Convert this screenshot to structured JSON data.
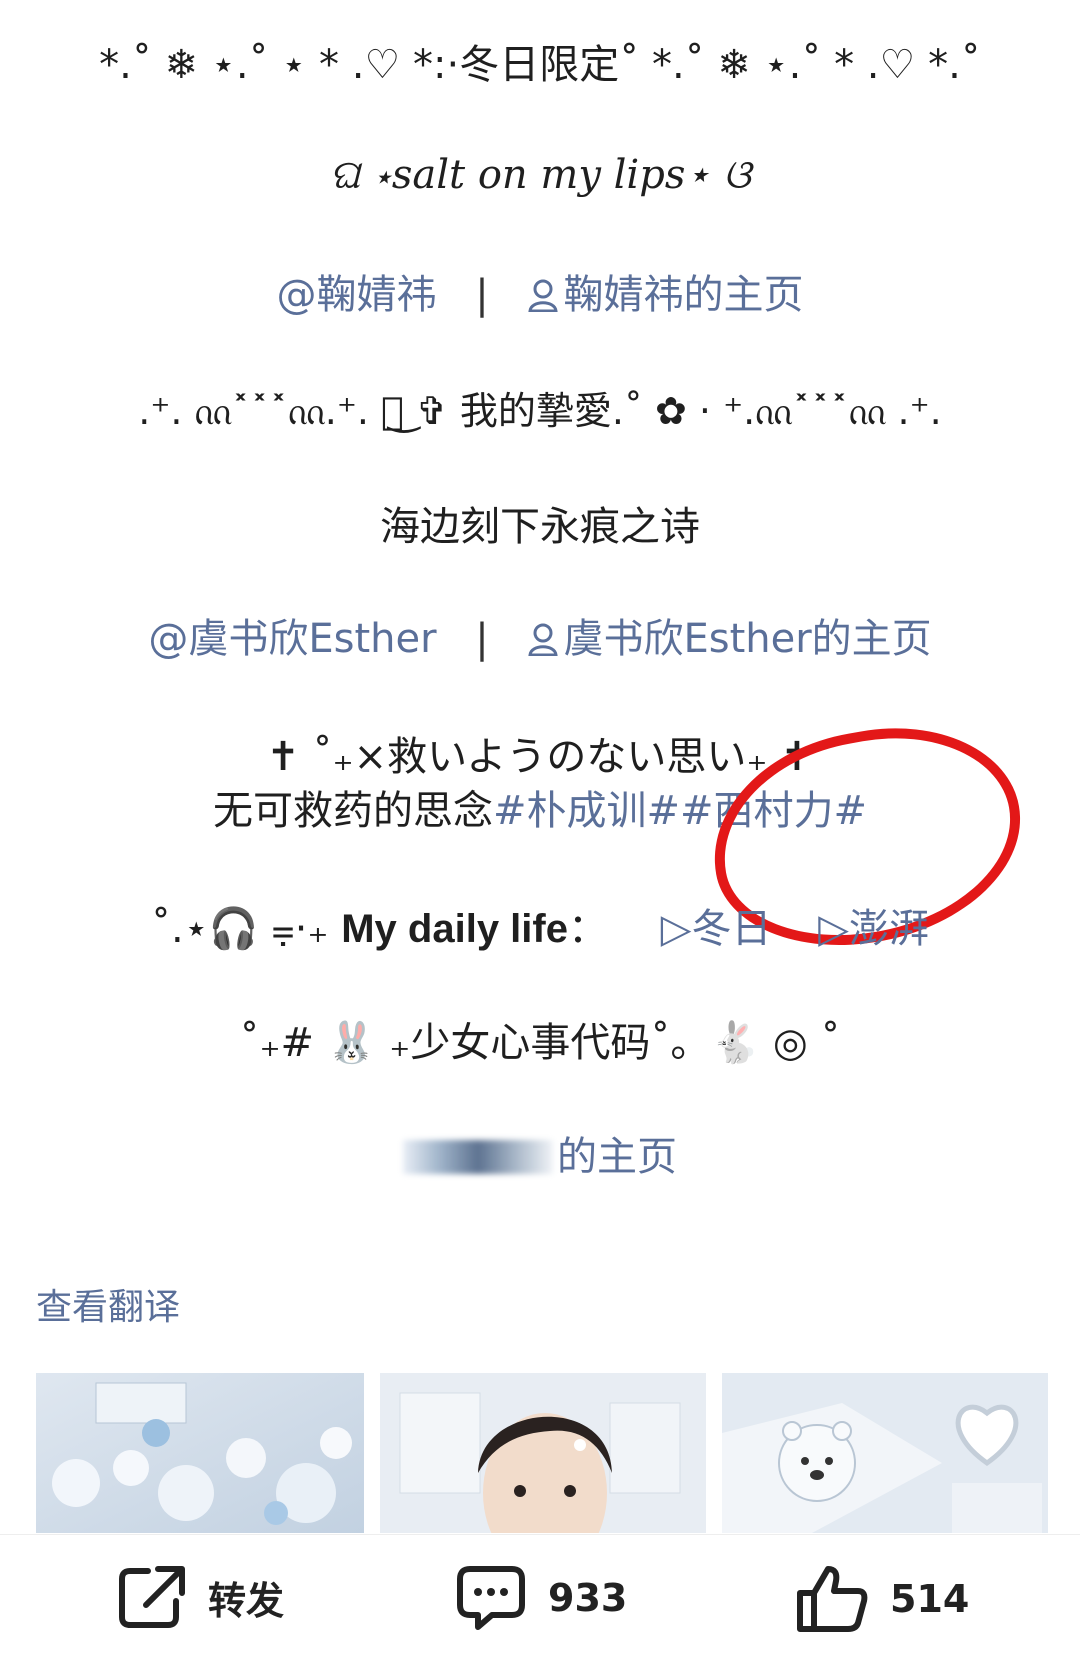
{
  "lines": {
    "winter": "*.˚ ❄ ⋆.˚ ⋆ * .♡ *:·冬日限定˚ *.˚ ❄ ⋆.˚ * .♡ *.˚",
    "salt": "ଘ ⋆salt on my lips⋆ ଓ",
    "mention1": "@鞠婧祎",
    "sep": "|",
    "home1": "鞠婧祎的主页",
    "love": ".⁺. ᦶ˟˟˟ᦶ.⁺. ᦶ͜ ✞ 我的摯愛.˚ ✿ · ⁺.ᦶ˟˟˟ᦶ .⁺.",
    "poem": "海边刻下永痕之诗",
    "mention2": "@虞书欣Esther",
    "home2": "虞书欣Esther的主页",
    "jp": "✝ ˚₊×救いようのない思い₊ ✝",
    "cn_prefix": "无可救药的思念",
    "tag1": "#朴成训#",
    "tag2": "#西村力#",
    "daily_prefix": "˚.⋆🎧 ⩦⋅₊ ",
    "daily_bold": "My daily life",
    "daily_colon": "：",
    "play1": "▷冬日",
    "play2": "▷澎湃",
    "girl": "˚₊# 🐰 ₊少女心事代码˚。🐇 ◎ ˚",
    "home3": "的主页"
  },
  "translate_label": "查看翻译",
  "actions": {
    "share_label": "转发",
    "comment_count": "933",
    "like_count": "514"
  },
  "colors": {
    "link": "#5a6f99",
    "highlight_circle": "#e31818"
  }
}
